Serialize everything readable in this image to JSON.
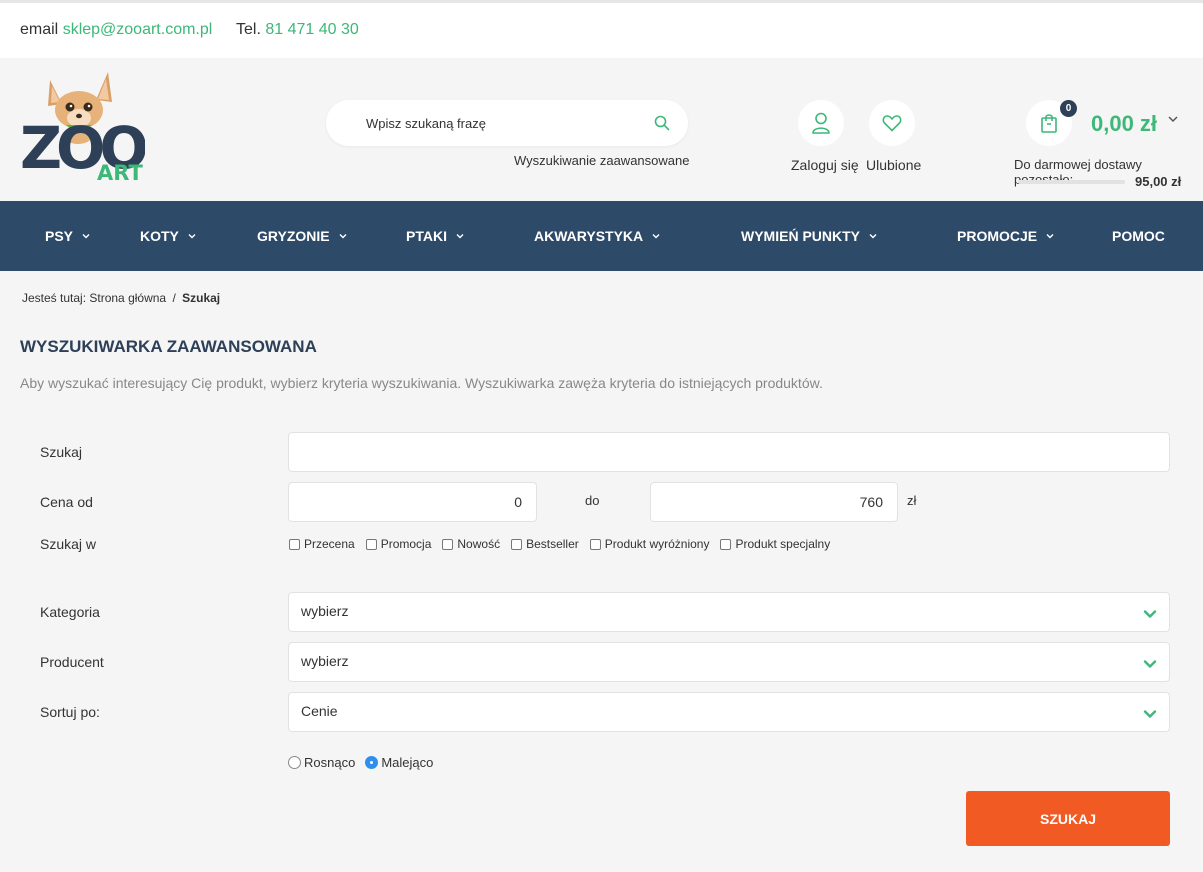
{
  "topbar": {
    "email_label": "email",
    "email": "sklep@zooart.com.pl",
    "tel_label": "Tel.",
    "tel": "81 471 40 30"
  },
  "header": {
    "logo": {
      "text_top": "ZOO",
      "text_bottom": "ART",
      "icon": "chihuahua-dog-mascot"
    },
    "search": {
      "placeholder": "Wpisz szukaną frazę",
      "icon": "search-icon"
    },
    "advanced_search": "Wyszukiwanie zaawansowane",
    "login_label": "Zaloguj się",
    "favorites_label": "Ulubione",
    "cart": {
      "count": "0",
      "total": "0,00 zł",
      "delivery_text": "Do darmowej dostawy pozostało:",
      "delivery_amount": "95,00 zł",
      "delivery_progress": 0
    }
  },
  "nav": {
    "items": [
      {
        "label": "PSY",
        "dropdown": true
      },
      {
        "label": "KOTY",
        "dropdown": true
      },
      {
        "label": "GRYZONIE",
        "dropdown": true
      },
      {
        "label": "PTAKI",
        "dropdown": true
      },
      {
        "label": "AKWARYSTYKA",
        "dropdown": true
      },
      {
        "label": "WYMIEŃ PUNKTY",
        "dropdown": true
      },
      {
        "label": "PROMOCJE",
        "dropdown": true
      },
      {
        "label": "POMOC",
        "dropdown": false
      }
    ]
  },
  "breadcrumb": {
    "prefix": "Jesteś tutaj:",
    "home": "Strona główna",
    "separator": "/",
    "current": "Szukaj"
  },
  "page": {
    "title": "WYSZUKIWARKA ZAAWANSOWANA",
    "description": "Aby wyszukać interesujący Cię produkt, wybierz kryteria wyszukiwania. Wyszukiwarka zawęża kryteria do istniejących produktów."
  },
  "form": {
    "search_label": "Szukaj",
    "search_value": "",
    "price_label": "Cena od",
    "price_from": "0",
    "price_to_label": "do",
    "price_to": "760",
    "currency": "zł",
    "search_in_label": "Szukaj w",
    "search_in_options": [
      "Przecena",
      "Promocja",
      "Nowość",
      "Bestseller",
      "Produkt wyróżniony",
      "Produkt specjalny"
    ],
    "category_label": "Kategoria",
    "category_value": "wybierz",
    "producer_label": "Producent",
    "producer_value": "wybierz",
    "sort_label": "Sortuj po:",
    "sort_value": "Cenie",
    "order_options": [
      {
        "label": "Rosnąco",
        "selected": false
      },
      {
        "label": "Malejąco",
        "selected": true
      }
    ],
    "submit_label": "SZUKAJ"
  },
  "colors": {
    "nav_bg": "#2e4a69",
    "accent_green": "#3cb878",
    "submit": "#f15a22",
    "radio_selected": "#2f8fef"
  }
}
